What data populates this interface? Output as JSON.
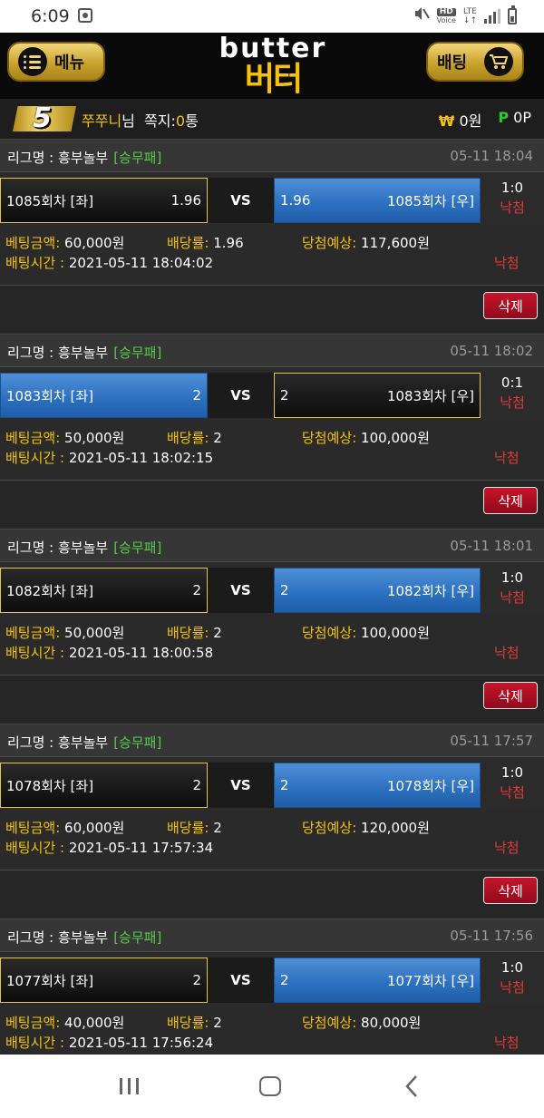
{
  "status_bar": {
    "time": "6:09",
    "hd": "HD",
    "voice": "Voice",
    "lte": "LTE"
  },
  "header": {
    "menu_label": "메뉴",
    "logo_en": "butter",
    "logo_ko": "버터",
    "bet_label": "배팅"
  },
  "user": {
    "level": "5",
    "name": "쭈쭈니",
    "suffix": "님",
    "note_label": "쪽지:",
    "note_count": "0",
    "note_unit": "통",
    "won_symbol": "₩",
    "won_value": "0원",
    "point_symbol": "P",
    "point_value": "0P"
  },
  "labels": {
    "league_prefix": "리그명 : ",
    "vs": "VS",
    "bet_amount": "베팅금액:",
    "odds": "배당률:",
    "expected": "당첨예상:",
    "bet_time": "배팅시간 :",
    "delete": "삭제"
  },
  "bets": [
    {
      "league": "흥부놀부",
      "type": "[승무패]",
      "date": "05-11 18:04",
      "left_team": "1085회차 [좌]",
      "left_odds": "1.96",
      "right_odds": "1.96",
      "right_team": "1085회차 [우]",
      "picked": "right",
      "score": "1:0",
      "result": "낙첨",
      "amount": "60,000원",
      "rate": "1.96",
      "expected": "117,600원",
      "time": "2021-05-11 18:04:02",
      "status": "낙첨"
    },
    {
      "league": "흥부놀부",
      "type": "[승무패]",
      "date": "05-11 18:02",
      "left_team": "1083회차 [좌]",
      "left_odds": "2",
      "right_odds": "2",
      "right_team": "1083회차 [우]",
      "picked": "left",
      "score": "0:1",
      "result": "낙첨",
      "amount": "50,000원",
      "rate": "2",
      "expected": "100,000원",
      "time": "2021-05-11 18:02:15",
      "status": "낙첨"
    },
    {
      "league": "흥부놀부",
      "type": "[승무패]",
      "date": "05-11 18:01",
      "left_team": "1082회차 [좌]",
      "left_odds": "2",
      "right_odds": "2",
      "right_team": "1082회차 [우]",
      "picked": "right",
      "score": "1:0",
      "result": "낙첨",
      "amount": "50,000원",
      "rate": "2",
      "expected": "100,000원",
      "time": "2021-05-11 18:00:58",
      "status": "낙첨"
    },
    {
      "league": "흥부놀부",
      "type": "[승무패]",
      "date": "05-11 17:57",
      "left_team": "1078회차 [좌]",
      "left_odds": "2",
      "right_odds": "2",
      "right_team": "1078회차 [우]",
      "picked": "right",
      "score": "1:0",
      "result": "낙첨",
      "amount": "60,000원",
      "rate": "2",
      "expected": "120,000원",
      "time": "2021-05-11 17:57:34",
      "status": "낙첨"
    },
    {
      "league": "흥부놀부",
      "type": "[승무패]",
      "date": "05-11 17:56",
      "left_team": "1077회차 [좌]",
      "left_odds": "2",
      "right_odds": "2",
      "right_team": "1077회차 [우]",
      "picked": "right",
      "score": "1:0",
      "result": "낙첨",
      "amount": "40,000원",
      "rate": "2",
      "expected": "80,000원",
      "time": "2021-05-11 17:56:24",
      "status": "낙첨"
    }
  ],
  "icons": [
    "menu-icon",
    "cart-icon",
    "mute-icon",
    "signal-icon",
    "battery-icon",
    "recent-apps-icon",
    "home-icon",
    "back-icon"
  ]
}
